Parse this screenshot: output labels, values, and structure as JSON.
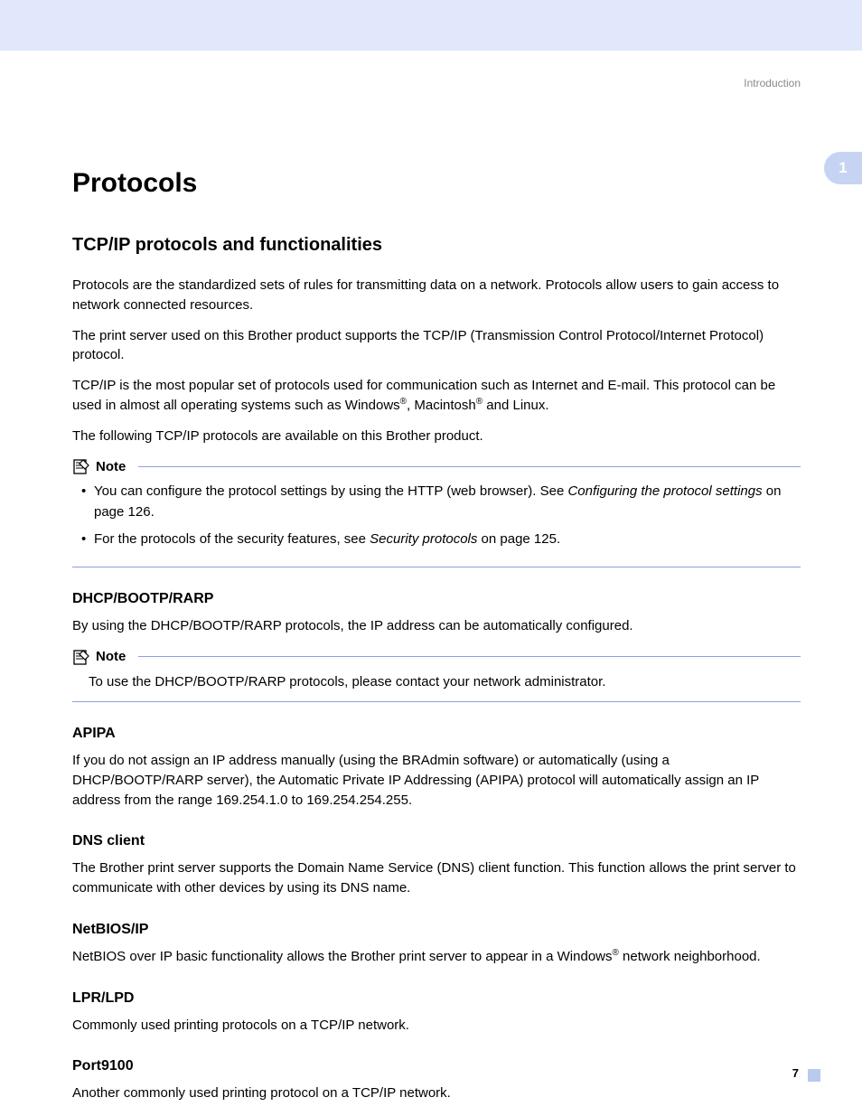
{
  "breadcrumb": "Introduction",
  "chapter_tab": "1",
  "page_number": "7",
  "h1": "Protocols",
  "h2": "TCP/IP protocols and functionalities",
  "intro": {
    "p1": "Protocols are the standardized sets of rules for transmitting data on a network. Protocols allow users to gain access to network connected resources.",
    "p2": "The print server used on this Brother product supports the TCP/IP (Transmission Control Protocol/Internet Protocol) protocol.",
    "p3_a": "TCP/IP is the most popular set of protocols used for communication such as Internet and E-mail. This protocol can be used in almost all operating systems such as Windows",
    "p3_b": ", Macintosh",
    "p3_c": " and Linux.",
    "p4": "The following TCP/IP protocols are available on this Brother product."
  },
  "note_label": "Note",
  "note1": {
    "li1_a": "You can configure the protocol settings by using the HTTP (web browser). See ",
    "li1_link": "Configuring the protocol settings",
    "li1_b": " on page 126.",
    "li2_a": "For the protocols of the security features, see ",
    "li2_link": "Security protocols",
    "li2_b": " on page 125."
  },
  "sections": {
    "dhcp": {
      "h": "DHCP/BOOTP/RARP",
      "p": "By using the DHCP/BOOTP/RARP protocols, the IP address can be automatically configured."
    },
    "note2": "To use the DHCP/BOOTP/RARP protocols, please contact your network administrator.",
    "apipa": {
      "h": "APIPA",
      "p": "If you do not assign an IP address manually (using the BRAdmin software) or automatically (using a DHCP/BOOTP/RARP server), the Automatic Private IP Addressing (APIPA) protocol will automatically assign an IP address from the range 169.254.1.0 to 169.254.254.255."
    },
    "dns": {
      "h": "DNS client",
      "p": "The Brother print server supports the Domain Name Service (DNS) client function. This function allows the print server to communicate with other devices by using its DNS name."
    },
    "netbios": {
      "h": "NetBIOS/IP",
      "p_a": "NetBIOS over IP basic functionality allows the Brother print server to appear in a Windows",
      "p_b": " network neighborhood."
    },
    "lpr": {
      "h": "LPR/LPD",
      "p": "Commonly used printing protocols on a TCP/IP network."
    },
    "port9100": {
      "h": "Port9100",
      "p": "Another commonly used printing protocol on a TCP/IP network."
    }
  }
}
